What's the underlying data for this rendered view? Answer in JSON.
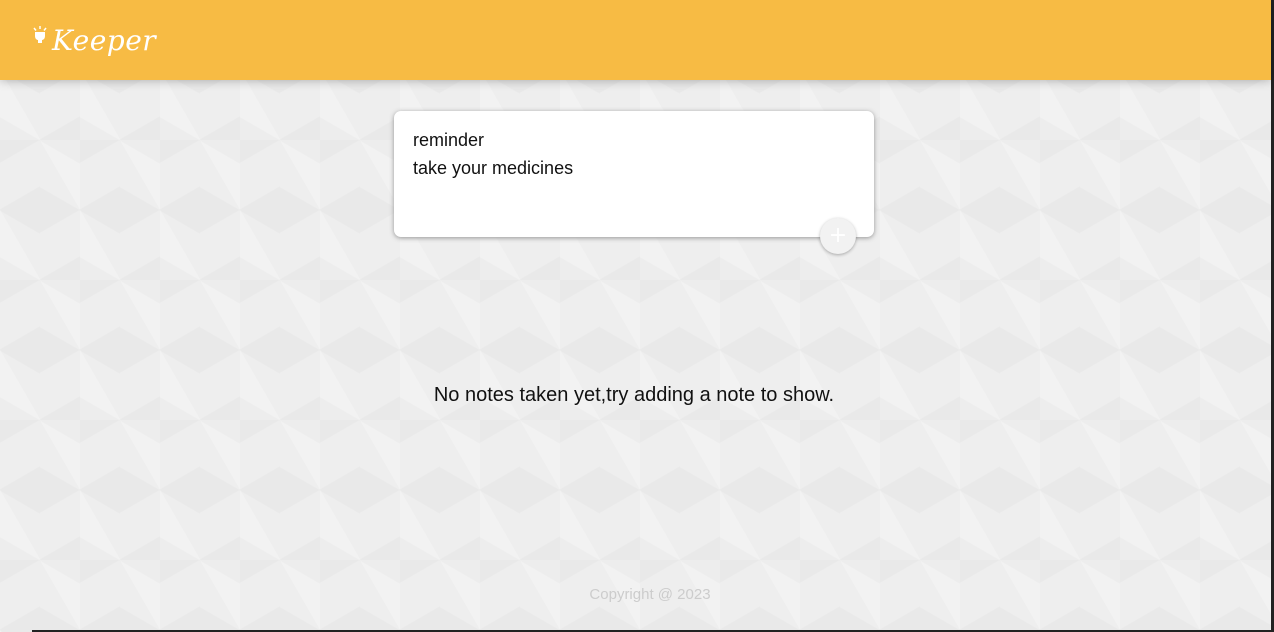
{
  "header": {
    "title": "Keeper",
    "logo_icon": "lamp-icon",
    "background_color": "#f7bb44"
  },
  "create_note": {
    "title_value": "reminder",
    "content_value": "take your medicines",
    "add_button_icon": "plus-icon",
    "add_button_label": "+"
  },
  "main": {
    "empty_message": "No notes taken yet,try adding a note to show."
  },
  "footer": {
    "copyright": "Copyright @ 2023"
  }
}
